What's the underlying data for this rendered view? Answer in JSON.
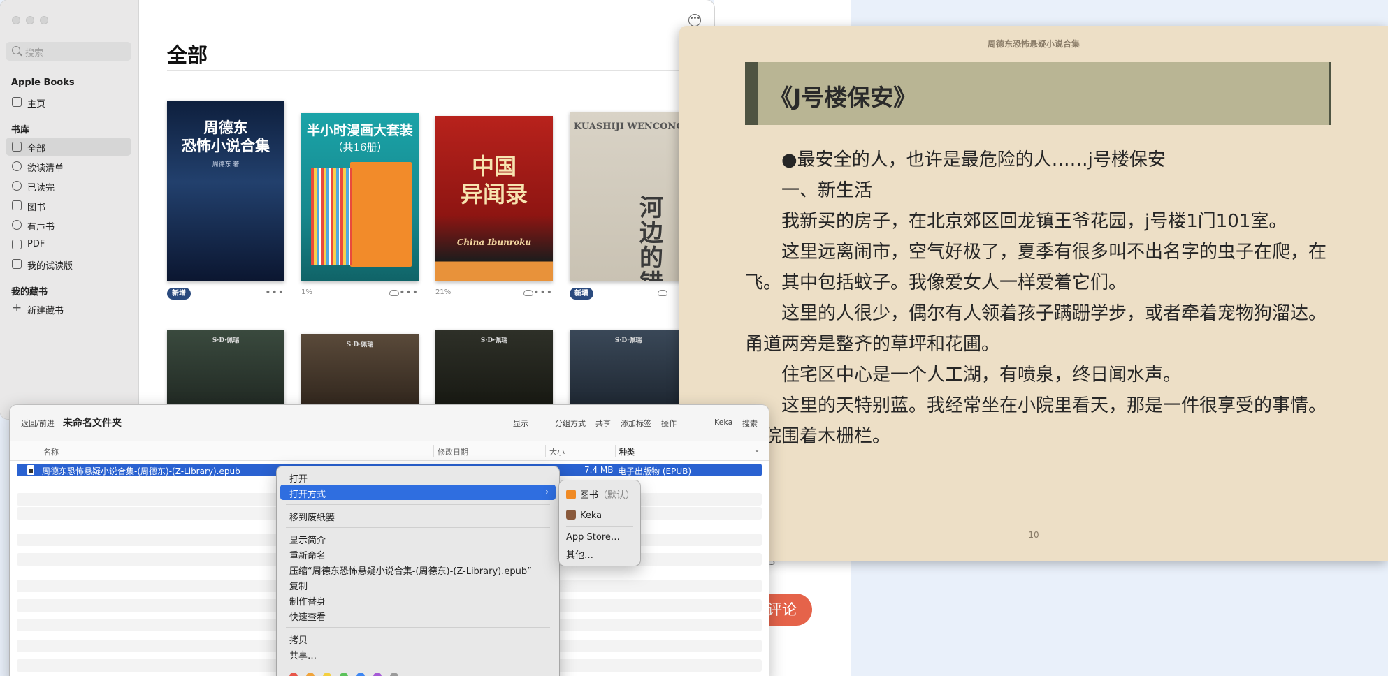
{
  "books_app": {
    "search_placeholder": "搜索",
    "app_name": "Apple Books",
    "home": "主页",
    "library_header": "书库",
    "library_items": [
      "全部",
      "欲读清单",
      "已读完",
      "图书",
      "有声书",
      "PDF",
      "我的试读版"
    ],
    "collections_header": "我的藏书",
    "new_collection": "新建藏书",
    "page_title": "全部",
    "books": [
      {
        "cover_title": "周德东\n恐怖小说合集",
        "cover_sub": "周德东 著",
        "status": "新增",
        "progress": ""
      },
      {
        "cover_title": "半小时漫画大套装",
        "cover_sub": "（共16册）",
        "status": "",
        "progress": "1%"
      },
      {
        "cover_title": "中国\n异闻录",
        "cover_sub": "China Ibunroku",
        "status": "",
        "progress": "21%"
      },
      {
        "cover_title": "河\n边\n的\n错\n误",
        "cover_sub": "KUASHIJI WENCONG",
        "status": "新增",
        "progress": ""
      }
    ],
    "row2_labels": [
      "S·D·佩瑞",
      "S·D·佩瑞",
      "S·D·佩瑞",
      "S·D·佩瑞"
    ],
    "more_glyph": "•••",
    "more_top_glyph": "•••"
  },
  "reader": {
    "header": "周德东恐怖悬疑小说合集",
    "chapter_title": "《J号楼保安》",
    "paragraphs": [
      "●最安全的人，也许是最危险的人……j号楼保安",
      "一、新生活",
      "我新买的房子，在北京郊区回龙镇王爷花园，j号楼1门101室。",
      "这里远离闹市，空气好极了，夏季有很多叫不出名字的虫子在爬，在飞。其中包括蚊子。我像爱女人一样爱着它们。",
      "这里的人很少，偶尔有人领着孩子蹒跚学步，或者牵着宠物狗溜达。甬道两旁是整齐的草坪和花圃。",
      "住宅区中心是一个人工湖，有喷泉，终日闻水声。",
      "这里的天特别蓝。我经常坐在小院里看天，那是一件很享受的事情。小院围着木栅栏。"
    ],
    "page_number": "10"
  },
  "background": {
    "review_button": "评论",
    "fragment": "3"
  },
  "finder": {
    "back_forward": "返回/前进",
    "folder_title": "未命名文件夹",
    "toolbar": {
      "view": "显示",
      "group": "分组方式",
      "share": "共享",
      "tags": "添加标签",
      "action": "操作",
      "keka": "Keka",
      "search": "搜索"
    },
    "columns": {
      "name": "名称",
      "modified": "修改日期",
      "size": "大小",
      "kind": "种类"
    },
    "file": {
      "name": "周德东恐怖悬疑小说合集-(周德东)-(Z-Library).epub",
      "size": "7.4 MB",
      "kind": "电子出版物 (EPUB)"
    }
  },
  "context_menu": {
    "open": "打开",
    "open_with": "打开方式",
    "move_to_trash": "移到废纸篓",
    "get_info": "显示简介",
    "rename": "重新命名",
    "compress": "压缩“周德东恐怖悬疑小说合集-(周德东)-(Z-Library).epub”",
    "duplicate": "复制",
    "make_alias": "制作替身",
    "quick_look": "快速查看",
    "copy": "拷贝",
    "share": "共享…",
    "submenu": {
      "books": "图书",
      "books_default": "（默认）",
      "keka": "Keka",
      "app_store": "App Store…",
      "other": "其他…"
    },
    "tag_colors": [
      "#e8564a",
      "#f0a33a",
      "#f4cf3f",
      "#5bc25a",
      "#3d86f2",
      "#a55ad6",
      "#9a9a9a"
    ]
  }
}
